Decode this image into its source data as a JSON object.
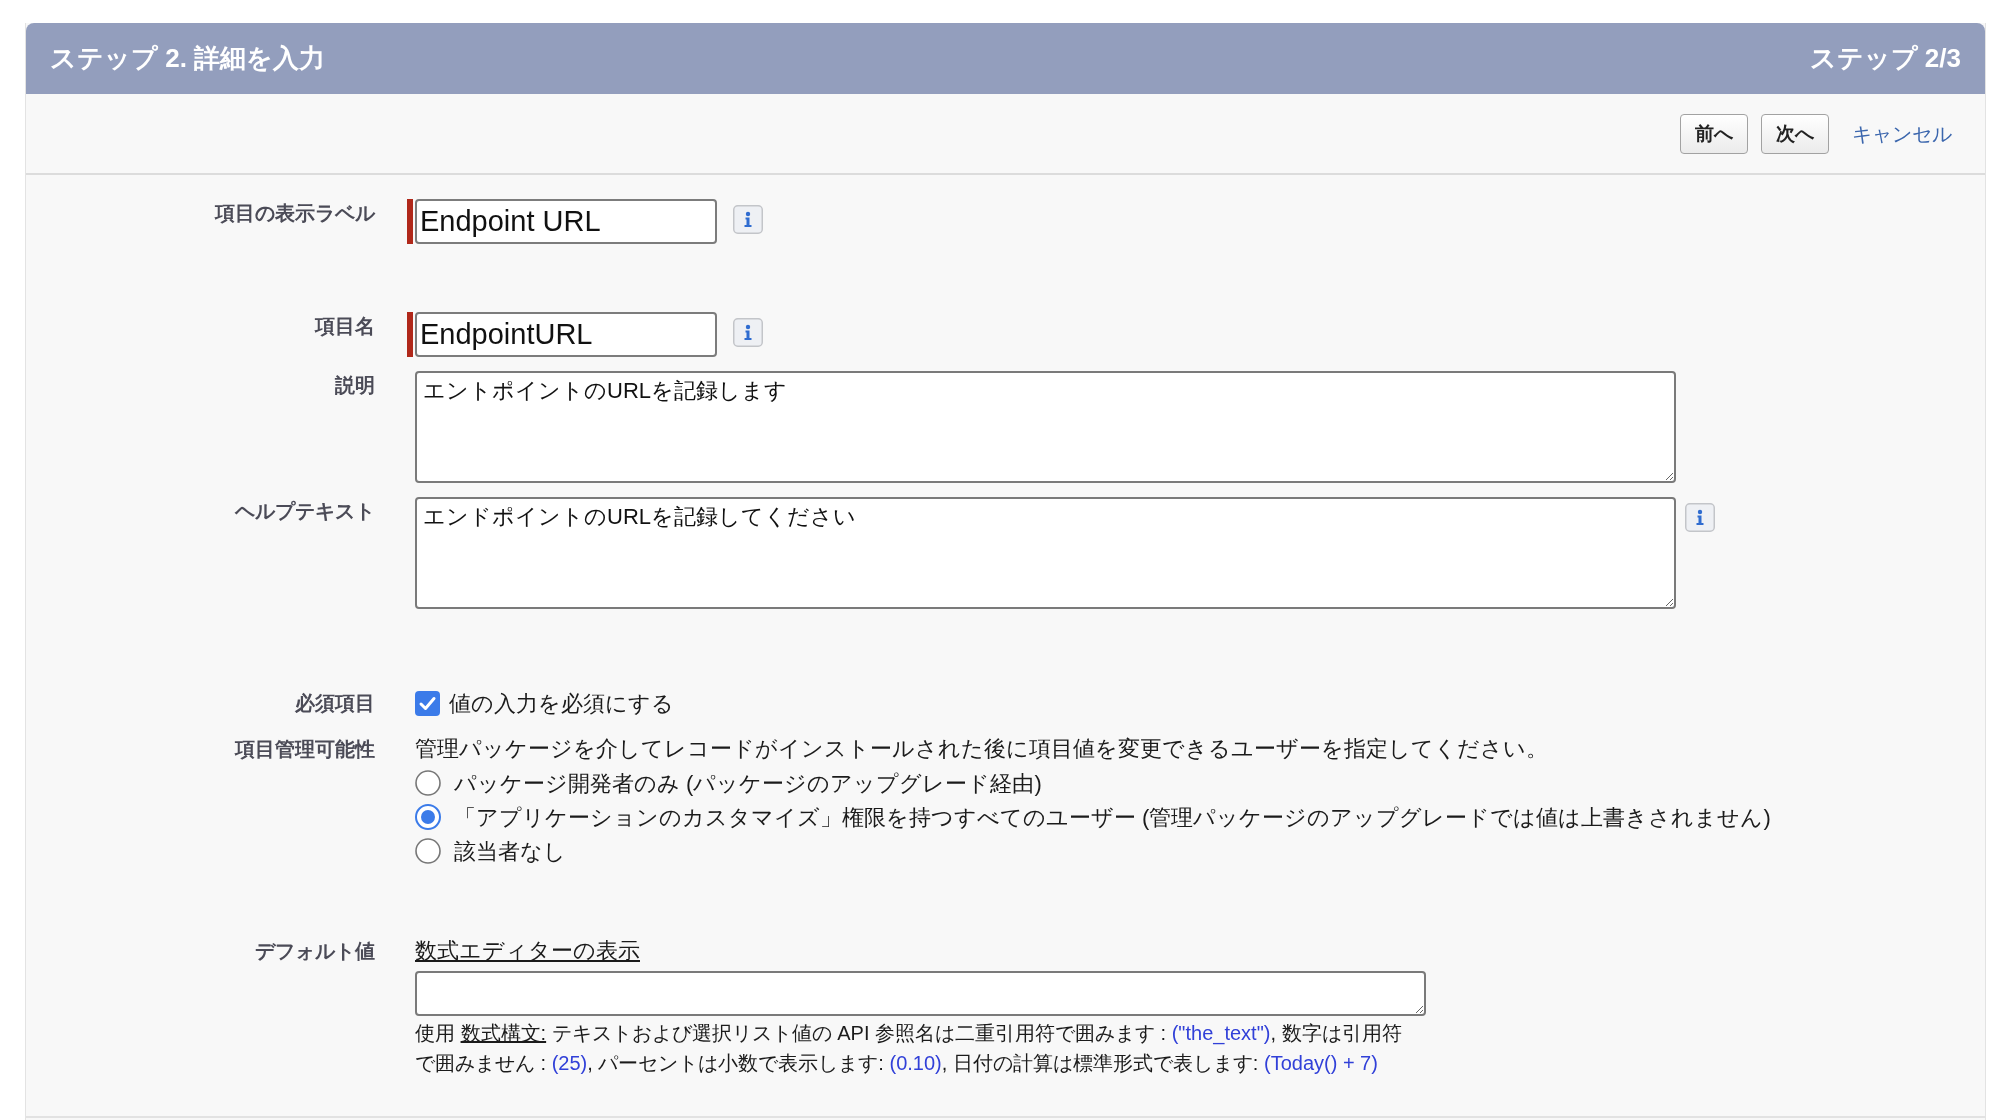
{
  "header": {
    "title": "ステップ 2. 詳細を入力",
    "step": "ステップ 2/3"
  },
  "toolbar": [
    {
      "kind": "button",
      "label": "前へ"
    },
    {
      "kind": "button",
      "label": "次へ"
    },
    {
      "kind": "link",
      "label": "キャンセル"
    }
  ],
  "fields": [
    {
      "kind": "text",
      "label": "項目の表示ラベル",
      "value": "Endpoint URL",
      "required": true,
      "info": true
    },
    {
      "kind": "text",
      "label": "項目名",
      "value": "EndpointURL",
      "required": true,
      "info": true
    },
    {
      "kind": "textarea",
      "label": "説明",
      "value": "エントポイントのURLを記録します",
      "required": false,
      "info": false
    },
    {
      "kind": "textarea",
      "label": "ヘルプテキスト",
      "value": "エンドポイントのURLを記録してください",
      "required": false,
      "info": true
    },
    {
      "kind": "checkbox",
      "label": "必須項目",
      "option": "値の入力を必須にする",
      "checked": true
    },
    {
      "kind": "radio",
      "label": "項目管理可能性",
      "description": "管理パッケージを介してレコードがインストールされた後に項目値を変更できるユーザーを指定してください。",
      "options": [
        {
          "label": "パッケージ開発者のみ (パッケージのアップグレード経由)",
          "selected": false
        },
        {
          "label": "「アプリケーションのカスタマイズ」権限を持つすべてのユーザー (管理パッケージのアップグレードでは値は上書きされません)",
          "selected": true
        },
        {
          "label": "該当者なし",
          "selected": false
        }
      ]
    },
    {
      "kind": "formula",
      "label": "デフォルト値",
      "link": "数式エディターの表示",
      "help": [
        {
          "kind": "text",
          "text": "使用 "
        },
        {
          "kind": "link",
          "text": "数式構文:"
        },
        {
          "kind": "text",
          "text": " テキストおよび選択リスト値の API 参照名は二重引用符で囲みます : "
        },
        {
          "kind": "code",
          "text": "(\"the_text\")"
        },
        {
          "kind": "text",
          "text": ", 数字は引用符で囲みません : "
        },
        {
          "kind": "code",
          "text": "(25)"
        },
        {
          "kind": "text",
          "text": ", パーセントは小数で表示します: "
        },
        {
          "kind": "code",
          "text": "(0.10)"
        },
        {
          "kind": "text",
          "text": ", 日付の計算は標準形式で表します: "
        },
        {
          "kind": "code",
          "text": "(Today() + 7)"
        }
      ]
    }
  ]
}
